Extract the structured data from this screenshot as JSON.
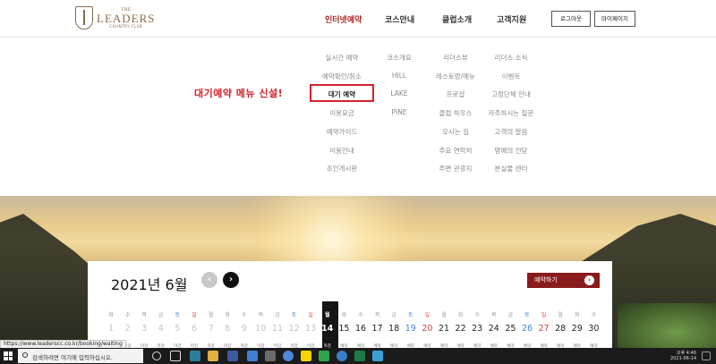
{
  "header": {
    "logo": {
      "the": "THE",
      "name": "LEADERS",
      "sub": "COUNTRY CLUB"
    },
    "nav": [
      {
        "label": "인터넷예약",
        "active": true
      },
      {
        "label": "코스안내",
        "active": false
      },
      {
        "label": "클럽소개",
        "active": false
      },
      {
        "label": "고객지원",
        "active": false
      }
    ],
    "logout_label": "로그아웃",
    "mypage_label": "마이페이지"
  },
  "mega_menu": {
    "columns": [
      [
        "실시간 예약",
        "예약확인/취소",
        "대기 예약",
        "이용요금",
        "예약가이드",
        "이용안내",
        "조인게시판"
      ],
      [
        "코스개요",
        "HILL",
        "LAKE",
        "PINE"
      ],
      [
        "리더스뷰",
        "레스토랑/메뉴",
        "프로샵",
        "클럽 하우스",
        "오시는 길",
        "주요 연락처",
        "주변 관광지"
      ],
      [
        "리더스 소식",
        "이벤트",
        "고정단체 안내",
        "자주하시는 질문",
        "고객의 말씀",
        "명예의 전당",
        "분실물 센터"
      ]
    ],
    "highlighted_item": "대기 예약"
  },
  "annotation": {
    "text": "대기예약 메뉴 신설!",
    "color": "#d4202a"
  },
  "calendar": {
    "title": "2021년 6월",
    "prev_label": "‹",
    "next_label": "›",
    "reserve_label": "예약하기",
    "reserve_arrow": "›",
    "weekdays": [
      "화",
      "수",
      "목",
      "금",
      "토",
      "일",
      "월",
      "화",
      "수",
      "목",
      "금",
      "토",
      "일",
      "월",
      "화",
      "수",
      "목",
      "금",
      "토",
      "일",
      "월",
      "화",
      "수",
      "목",
      "금",
      "토",
      "일",
      "월",
      "화",
      "수"
    ],
    "dates": [
      1,
      2,
      3,
      4,
      5,
      6,
      7,
      8,
      9,
      10,
      11,
      12,
      13,
      14,
      15,
      16,
      17,
      18,
      19,
      20,
      21,
      22,
      23,
      24,
      25,
      26,
      27,
      28,
      29,
      30
    ],
    "today": 14,
    "tags": [
      "마감",
      "마감",
      "마감",
      "마감",
      "마감",
      "마감",
      "마감",
      "마감",
      "마감",
      "마감",
      "마감",
      "마감",
      "마감",
      "마감",
      "예약",
      "예약",
      "예약",
      "예약",
      "예약",
      "예약",
      "예약",
      "예약",
      "예약",
      "예약",
      "예약",
      "예약",
      "예약",
      "예약",
      "예약",
      "예약"
    ]
  },
  "browser_status": {
    "url": "https://www.leaderscc.co.kr/booking/waiting"
  },
  "taskbar": {
    "search_placeholder": "검색하려면 여기에 입력하십시오.",
    "time": "오후 4:46",
    "date": "2021-06-14"
  },
  "colors": {
    "accent": "#b02a2a",
    "brand": "#8b6a4a",
    "reserve": "#8a1b1d"
  }
}
